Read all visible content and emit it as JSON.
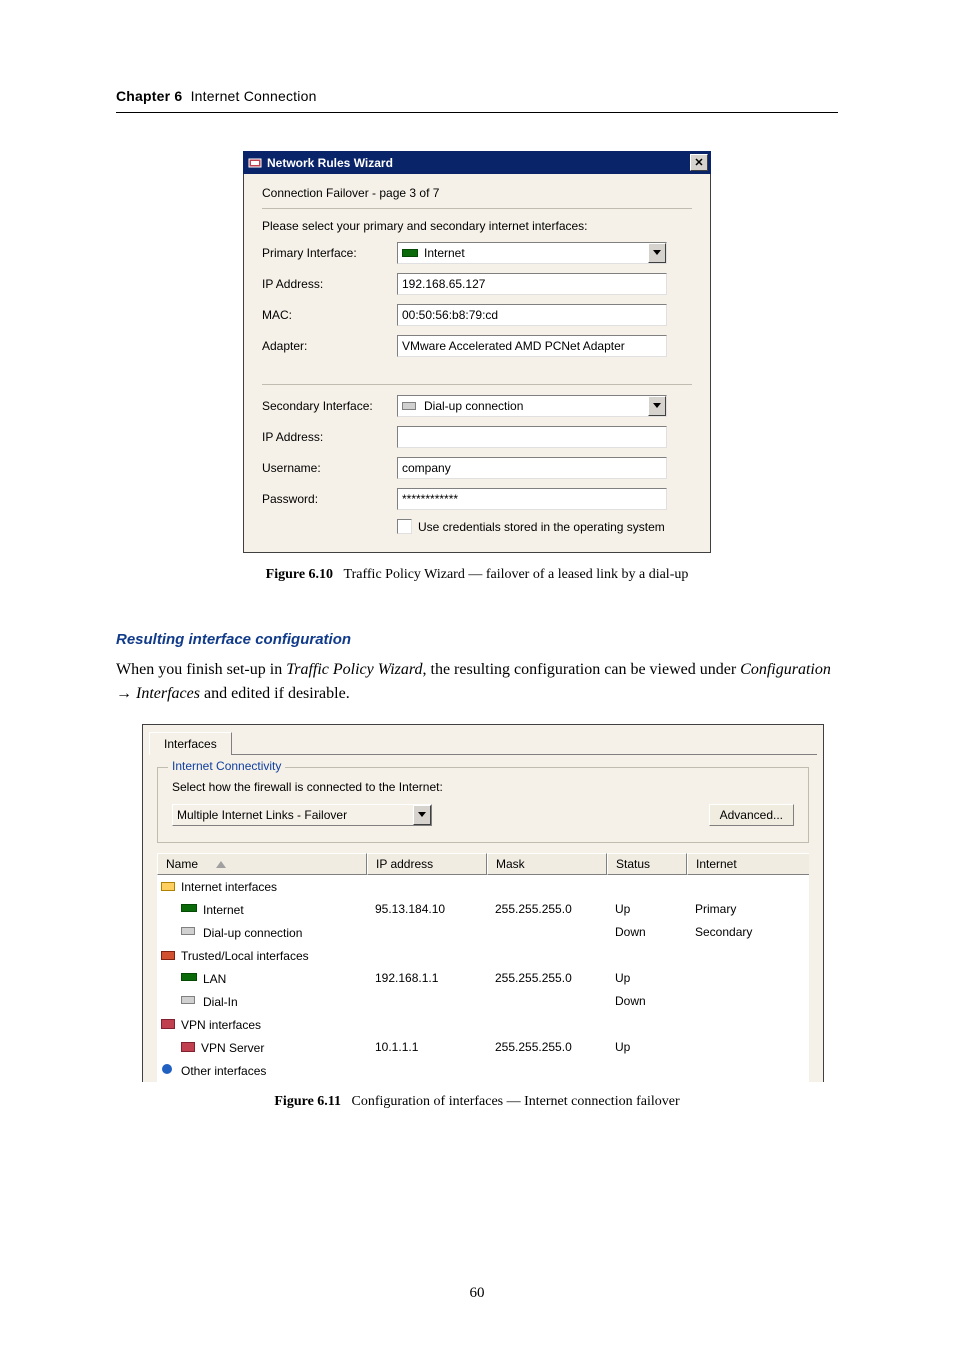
{
  "running_head": {
    "chapter": "Chapter 6",
    "title": "Internet Connection"
  },
  "wizard": {
    "window_title": "Network Rules Wizard",
    "page_title": "Connection Failover - page 3 of 7",
    "instruction": "Please select your primary and secondary internet interfaces:",
    "primary": {
      "label": "Primary Interface:",
      "value": "Internet",
      "ip_label": "IP Address:",
      "ip": "192.168.65.127",
      "mac_label": "MAC:",
      "mac": "00:50:56:b8:79:cd",
      "adapter_label": "Adapter:",
      "adapter": "VMware Accelerated AMD PCNet Adapter"
    },
    "secondary": {
      "label": "Secondary Interface:",
      "value": "Dial-up connection",
      "ip_label": "IP Address:",
      "ip": "",
      "user_label": "Username:",
      "user": "company",
      "pass_label": "Password:",
      "pass": "************",
      "cred_checkbox": "Use credentials stored in the operating system"
    }
  },
  "fig610": {
    "label": "Figure 6.10",
    "text": "Traffic Policy Wizard — failover of a leased link by a dial-up"
  },
  "section_title": "Resulting interface configuration",
  "para": {
    "pre": "When you finish set-up in ",
    "em1": "Traffic Policy Wizard",
    "mid": ", the resulting configuration can be viewed under ",
    "em2": "Configuration",
    "arrow": " → ",
    "em3": "Interfaces",
    "post": " and edited if desirable."
  },
  "interfaces_panel": {
    "tab": "Interfaces",
    "legend": "Internet Connectivity",
    "help": "Select how the firewall is connected to the Internet:",
    "mode": "Multiple Internet Links - Failover",
    "advanced": "Advanced...",
    "columns": {
      "name": "Name",
      "ip": "IP address",
      "mask": "Mask",
      "status": "Status",
      "internet": "Internet"
    },
    "rows": [
      {
        "type": "group",
        "icon": "folder",
        "name": "Internet interfaces"
      },
      {
        "type": "leaf",
        "icon": "nic",
        "name": "Internet",
        "ip": "95.13.184.10",
        "mask": "255.255.255.0",
        "status": "Up",
        "internet": "Primary"
      },
      {
        "type": "leaf",
        "icon": "modem",
        "name": "Dial-up connection",
        "ip": "",
        "mask": "",
        "status": "Down",
        "internet": "Secondary"
      },
      {
        "type": "group",
        "icon": "trusted",
        "name": "Trusted/Local interfaces"
      },
      {
        "type": "leaf",
        "icon": "nic",
        "name": "LAN",
        "ip": "192.168.1.1",
        "mask": "255.255.255.0",
        "status": "Up",
        "internet": ""
      },
      {
        "type": "leaf",
        "icon": "modem",
        "name": "Dial-In",
        "ip": "",
        "mask": "",
        "status": "Down",
        "internet": ""
      },
      {
        "type": "group",
        "icon": "vpn",
        "name": "VPN interfaces"
      },
      {
        "type": "leaf",
        "icon": "vpn",
        "name": "VPN Server",
        "ip": "10.1.1.1",
        "mask": "255.255.255.0",
        "status": "Up",
        "internet": ""
      },
      {
        "type": "group",
        "icon": "other",
        "name": "Other interfaces"
      }
    ]
  },
  "fig611": {
    "label": "Figure 6.11",
    "text": "Configuration of interfaces — Internet connection failover"
  },
  "page_number": "60"
}
